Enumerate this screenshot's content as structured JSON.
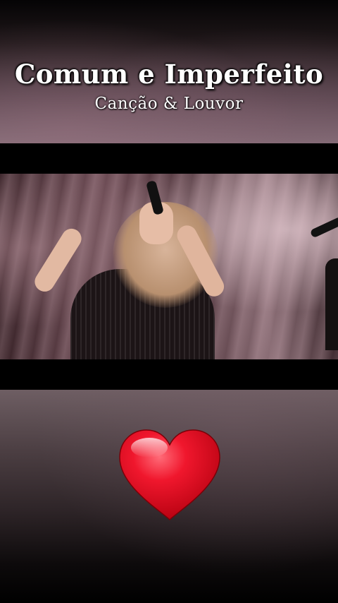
{
  "overlay": {
    "title": "Comum e Imperfeito",
    "subtitle": "Canção & Louvor"
  },
  "icons": {
    "heart": "red-heart-emoji"
  },
  "colors": {
    "heart": "#e3001b",
    "text": "#ffffff"
  }
}
